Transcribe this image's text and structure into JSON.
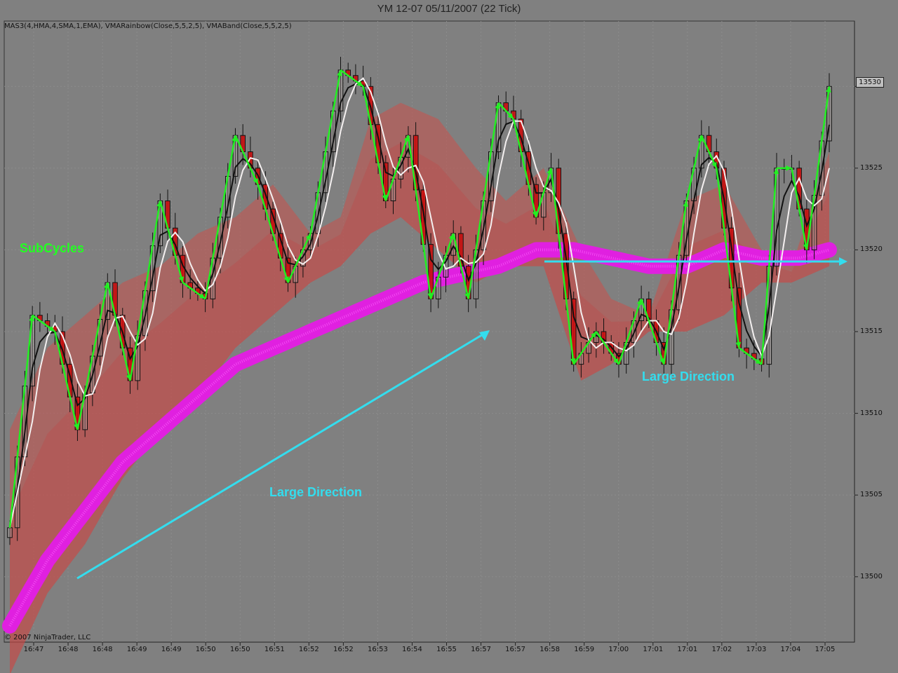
{
  "window": {
    "title": "YM 12-07  05/11/2007  (22 Tick)"
  },
  "indicators": "MAS3(4,HMA,4,SMA,1,EMA), VMARainbow(Close,5,5,2,5), VMABand(Close,5,5,2,5)",
  "copyright": "© 2007 NinjaTrader, LLC",
  "annotations": {
    "subcycles": "SubCycles",
    "large_direction_1": "Large Direction",
    "large_direction_2": "Large Direction"
  },
  "price_tag": "13530",
  "colors": {
    "background": "#808080",
    "band": "#c8504a",
    "rainbow": "#e020e0",
    "annotation_green": "#22ff22",
    "annotation_cyan": "#33ddee",
    "bull_candle": "#ffffff",
    "bear_candle": "#cc1111"
  },
  "chart_data": {
    "type": "candlestick",
    "y_axis": {
      "ticks": [
        "13530",
        "13525",
        "13520",
        "13515",
        "13510",
        "13505",
        "13500"
      ],
      "range": [
        13496,
        13534
      ]
    },
    "x_axis": {
      "ticks": [
        "16:47",
        "16:48",
        "16:48",
        "16:49",
        "16:49",
        "16:50",
        "16:50",
        "16:51",
        "16:52",
        "16:52",
        "16:53",
        "16:54",
        "16:55",
        "16:57",
        "16:57",
        "16:58",
        "16:59",
        "17:00",
        "17:01",
        "17:01",
        "17:02",
        "17:03",
        "17:04",
        "17:05"
      ]
    },
    "price_path": [
      [
        0,
        13503
      ],
      [
        3,
        13516
      ],
      [
        6,
        13515
      ],
      [
        9,
        13509
      ],
      [
        13,
        13518
      ],
      [
        16,
        13512
      ],
      [
        20,
        13523
      ],
      [
        23,
        13518
      ],
      [
        26,
        13517
      ],
      [
        30,
        13527
      ],
      [
        33,
        13524
      ],
      [
        37,
        13518
      ],
      [
        40,
        13521
      ],
      [
        44,
        13531
      ],
      [
        47,
        13530
      ],
      [
        50,
        13523
      ],
      [
        53,
        13527
      ],
      [
        56,
        13517
      ],
      [
        59,
        13521
      ],
      [
        61,
        13517
      ],
      [
        65,
        13529
      ],
      [
        67,
        13528
      ],
      [
        70,
        13522
      ],
      [
        72,
        13525
      ],
      [
        75,
        13513
      ],
      [
        78,
        13515
      ],
      [
        81,
        13513
      ],
      [
        84,
        13517
      ],
      [
        87,
        13513
      ],
      [
        90,
        13523
      ],
      [
        92,
        13527
      ],
      [
        94,
        13525
      ],
      [
        97,
        13514
      ],
      [
        100,
        13513
      ],
      [
        102,
        13525
      ],
      [
        104,
        13525
      ],
      [
        106,
        13520
      ],
      [
        109,
        13530
      ]
    ],
    "band_upper": [
      [
        0,
        13509
      ],
      [
        5,
        13514
      ],
      [
        10,
        13516
      ],
      [
        15,
        13518
      ],
      [
        20,
        13519
      ],
      [
        25,
        13521
      ],
      [
        30,
        13522
      ],
      [
        35,
        13524
      ],
      [
        40,
        13521
      ],
      [
        44,
        13522
      ],
      [
        48,
        13528
      ],
      [
        52,
        13529
      ],
      [
        57,
        13528
      ],
      [
        62,
        13525
      ],
      [
        66,
        13523
      ],
      [
        71,
        13525
      ],
      [
        76,
        13520
      ],
      [
        80,
        13517
      ],
      [
        85,
        13516
      ],
      [
        90,
        13523
      ],
      [
        95,
        13524
      ],
      [
        100,
        13520
      ],
      [
        104,
        13519
      ],
      [
        109,
        13526
      ]
    ],
    "band_lower": [
      [
        0,
        13494
      ],
      [
        5,
        13499
      ],
      [
        10,
        13502
      ],
      [
        15,
        13506
      ],
      [
        20,
        13509
      ],
      [
        25,
        13511
      ],
      [
        30,
        13514
      ],
      [
        35,
        13516
      ],
      [
        40,
        13518
      ],
      [
        44,
        13519
      ],
      [
        48,
        13521
      ],
      [
        52,
        13522
      ],
      [
        57,
        13520
      ],
      [
        62,
        13518
      ],
      [
        66,
        13519
      ],
      [
        71,
        13519
      ],
      [
        76,
        13512
      ],
      [
        80,
        13513
      ],
      [
        85,
        13515
      ],
      [
        90,
        13515
      ],
      [
        95,
        13516
      ],
      [
        100,
        13518
      ],
      [
        104,
        13518
      ],
      [
        109,
        13519
      ]
    ],
    "rainbow": [
      [
        0,
        13497
      ],
      [
        5,
        13501
      ],
      [
        10,
        13504
      ],
      [
        15,
        13507
      ],
      [
        20,
        13509
      ],
      [
        25,
        13511
      ],
      [
        30,
        13513
      ],
      [
        35,
        13514
      ],
      [
        40,
        13515
      ],
      [
        45,
        13516
      ],
      [
        50,
        13517
      ],
      [
        55,
        13518
      ],
      [
        60,
        13518.5
      ],
      [
        65,
        13519
      ],
      [
        70,
        13520
      ],
      [
        75,
        13520
      ],
      [
        80,
        13519.5
      ],
      [
        85,
        13519
      ],
      [
        90,
        13519
      ],
      [
        95,
        13520
      ],
      [
        100,
        13519.5
      ],
      [
        105,
        13519.5
      ],
      [
        109,
        13520
      ]
    ]
  }
}
